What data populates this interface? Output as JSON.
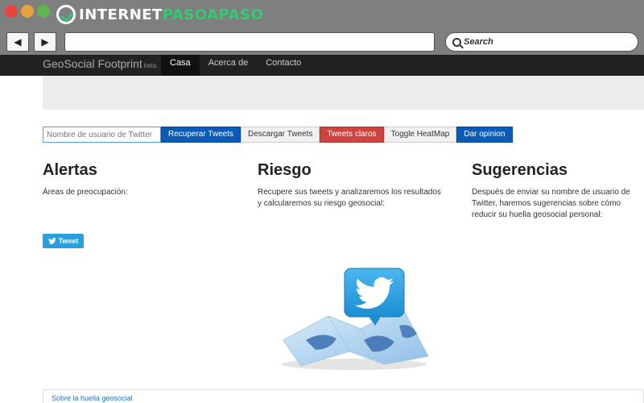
{
  "browser": {
    "watermark_prefix": "INTERNET",
    "watermark_accent": "PASOAPASO",
    "back_glyph": "◀",
    "forward_glyph": "▶",
    "search_label": "Search"
  },
  "site": {
    "brand": "GeoSocial Footprint",
    "brand_tag": "beta",
    "menu": [
      {
        "label": "Casa",
        "active": true
      },
      {
        "label": "Acerca de",
        "active": false
      },
      {
        "label": "Contacto",
        "active": false
      }
    ]
  },
  "toolbar": {
    "input_placeholder": "Nombre de usuario de Twitter",
    "buttons": [
      {
        "label": "Recuperar Tweets",
        "style": "primary"
      },
      {
        "label": "Descargar Tweets",
        "style": "default"
      },
      {
        "label": "Tweets claros",
        "style": "danger"
      },
      {
        "label": "Toggle HeatMap",
        "style": "default"
      },
      {
        "label": "Dar opinion",
        "style": "primary"
      }
    ]
  },
  "columns": {
    "alertas": {
      "title": "Alertas",
      "text": "Áreas de preocupación:"
    },
    "riesgo": {
      "title": "Riesgo",
      "text": "Recupere sus tweets y analizaremos los resultados y calcularemos su riesgo geosocial:"
    },
    "sugerencias": {
      "title": "Sugerencias",
      "text": "Después de enviar su nombre de usuario de Twitter, haremos sugerencias sobre cómo reducir su huella geosocial personal:"
    }
  },
  "tweet_button": {
    "label": "Tweet"
  },
  "footer": {
    "link": "Sobre la huella geosocial"
  },
  "colors": {
    "primary": "#0a5ab8",
    "danger": "#d0423e",
    "twitter": "#2b9fdc",
    "watermark_green": "#2ecc71"
  }
}
